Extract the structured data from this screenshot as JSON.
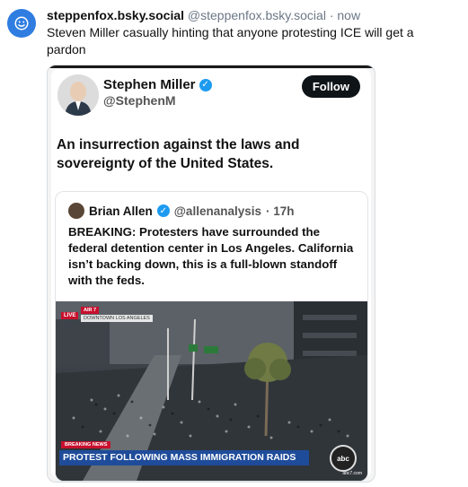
{
  "post": {
    "display_name": "steppenfox.bsky.social",
    "handle": "@steppenfox.bsky.social",
    "separator": "·",
    "time": "now",
    "text": "Steven Miller casually hinting that anyone protesting ICE will get a pardon"
  },
  "embed": {
    "tweet": {
      "author_name": "Stephen Miller",
      "author_handle": "@StephenM",
      "follow_label": "Follow",
      "text": "An insurrection against the laws and sovereignty of the United States."
    },
    "quoted": {
      "author_name": "Brian Allen",
      "author_handle": "@allenanalysis",
      "time": "· 17h",
      "text": "BREAKING: Protesters have surrounded the federal detention center in Los Angeles. California isn’t backing down, this is a full-blown standoff with the feds."
    },
    "video": {
      "live_label": "LIVE",
      "air_label": "AIR 7",
      "location_label": "DOWNTOWN LOS ANGELES",
      "breaking_label": "BREAKING NEWS",
      "headline": "PROTEST FOLLOWING MASS IMMIGRATION RAIDS",
      "logo": "abc",
      "logo_url": "abc7.com"
    }
  },
  "colors": {
    "avatar_bg": "#2f7de1",
    "verified": "#1d9bf0",
    "lower_third": "#1f4c9a",
    "breaking_red": "#c8102e"
  },
  "icons": {
    "account_avatar": "smiley-face-icon",
    "verified": "verified-check-icon"
  }
}
